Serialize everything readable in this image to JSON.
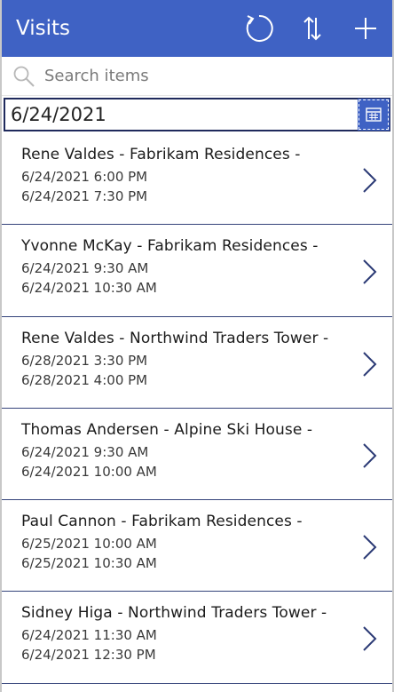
{
  "header": {
    "title": "Visits",
    "icons": [
      "refresh-icon",
      "sort-icon",
      "add-icon"
    ],
    "bg_color": "#3f62c4"
  },
  "search": {
    "placeholder": "Search items",
    "value": ""
  },
  "date_picker": {
    "value": "6/24/2021"
  },
  "visits": [
    {
      "title": "Rene Valdes - Fabrikam Residences -",
      "start": "6/24/2021 6:00 PM",
      "end": "6/24/2021 7:30 PM"
    },
    {
      "title": "Yvonne McKay - Fabrikam Residences -",
      "start": "6/24/2021 9:30 AM",
      "end": "6/24/2021 10:30 AM"
    },
    {
      "title": "Rene Valdes - Northwind Traders Tower -",
      "start": "6/28/2021 3:30 PM",
      "end": "6/28/2021 4:00 PM"
    },
    {
      "title": "Thomas Andersen - Alpine Ski House -",
      "start": "6/24/2021 9:30 AM",
      "end": "6/24/2021 10:00 AM"
    },
    {
      "title": "Paul Cannon - Fabrikam Residences -",
      "start": "6/25/2021 10:00 AM",
      "end": "6/25/2021 10:30 AM"
    },
    {
      "title": "Sidney Higa - Northwind Traders Tower -",
      "start": "6/24/2021 11:30 AM",
      "end": "6/24/2021 12:30 PM"
    }
  ]
}
